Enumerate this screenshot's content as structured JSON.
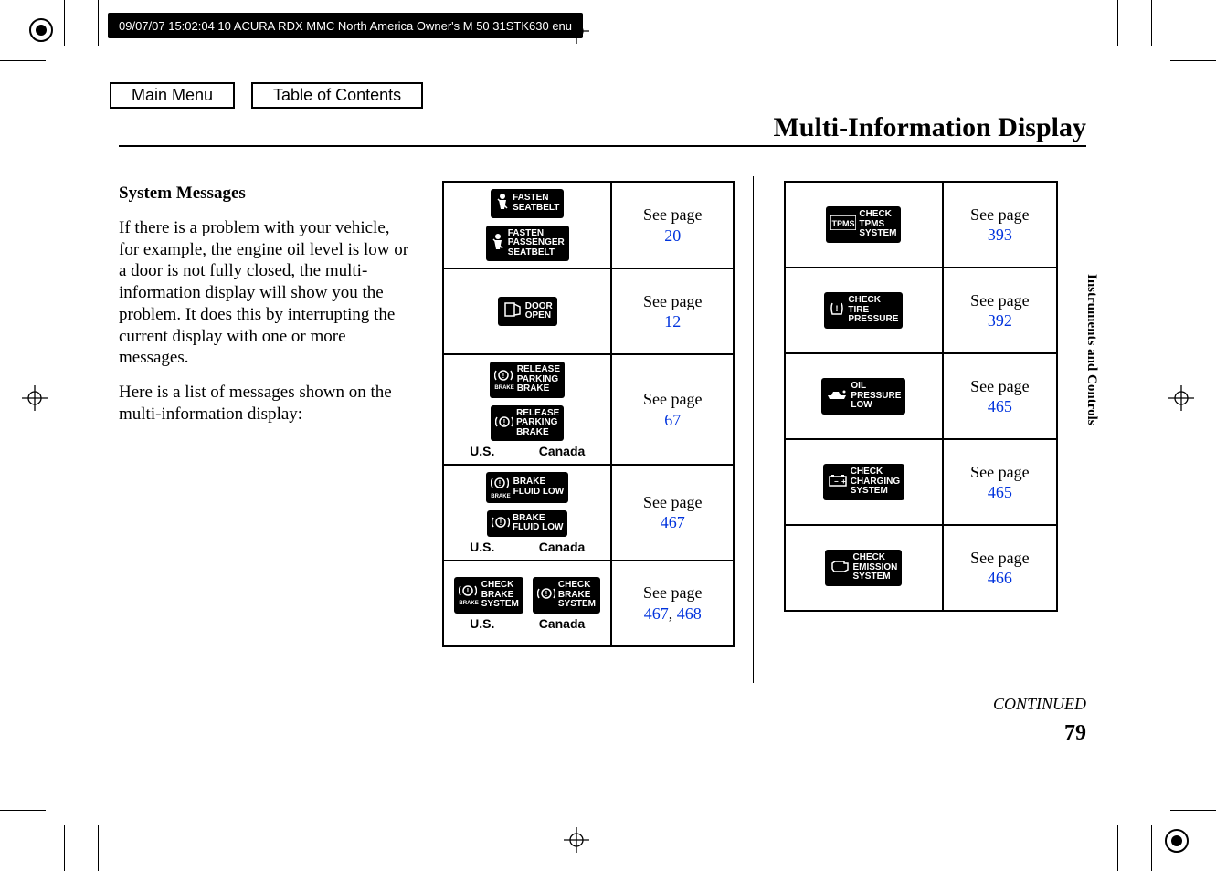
{
  "header_text": "09/07/07 15:02:04   10 ACURA RDX MMC North America Owner's M 50 31STK630 enu",
  "nav": {
    "main_menu": "Main Menu",
    "toc": "Table of Contents"
  },
  "page_title": "Multi-Information Display",
  "section": {
    "heading": "System Messages",
    "para1": "If there is a problem with your vehicle, for example, the engine oil level is low or a door is not fully closed, the multi-information display will show you the problem. It does this by interrupting the current display with one or more messages.",
    "para2": "Here is a list of messages shown on the multi-information display:"
  },
  "see_page_label": "See page",
  "variant_us": "U.S.",
  "variant_canada": "Canada",
  "left_table": [
    {
      "variant_row": false,
      "indicators": [
        {
          "name": "fasten-seatbelt-indicator",
          "text": "FASTEN\nSEATBELT"
        },
        {
          "name": "fasten-passenger-seatbelt-indicator",
          "text": "FASTEN\nPASSENGER\nSEATBELT"
        }
      ],
      "pages": [
        "20"
      ]
    },
    {
      "variant_row": false,
      "indicators": [
        {
          "name": "door-open-indicator",
          "text": "DOOR\nOPEN"
        }
      ],
      "pages": [
        "12"
      ]
    },
    {
      "variant_row": true,
      "indicators": [
        {
          "name": "release-parking-brake-us-indicator",
          "text": "RELEASE\nPARKING\nBRAKE",
          "prefix": "BRAKE"
        },
        {
          "name": "release-parking-brake-canada-indicator",
          "text": "RELEASE\nPARKING\nBRAKE"
        }
      ],
      "pages": [
        "67"
      ]
    },
    {
      "variant_row": true,
      "indicators": [
        {
          "name": "brake-fluid-low-us-indicator",
          "text": "BRAKE\nFLUID LOW",
          "prefix": "BRAKE"
        },
        {
          "name": "brake-fluid-low-canada-indicator",
          "text": "BRAKE\nFLUID LOW"
        }
      ],
      "pages": [
        "467"
      ]
    },
    {
      "variant_row": true,
      "indicators": [
        {
          "name": "check-brake-system-us-indicator",
          "text": "CHECK\nBRAKE\nSYSTEM",
          "prefix": "BRAKE"
        },
        {
          "name": "check-brake-system-canada-indicator",
          "text": "CHECK\nBRAKE\nSYSTEM"
        }
      ],
      "pages": [
        "467",
        "468"
      ]
    }
  ],
  "right_table": [
    {
      "indicators": [
        {
          "name": "check-tpms-system-indicator",
          "text": "CHECK\nTPMS\nSYSTEM",
          "prefix_box": "TPMS"
        }
      ],
      "pages": [
        "393"
      ]
    },
    {
      "indicators": [
        {
          "name": "check-tire-pressure-indicator",
          "text": "CHECK\nTIRE\nPRESSURE"
        }
      ],
      "pages": [
        "392"
      ]
    },
    {
      "indicators": [
        {
          "name": "oil-pressure-low-indicator",
          "text": "OIL\nPRESSURE\nLOW"
        }
      ],
      "pages": [
        "465"
      ]
    },
    {
      "indicators": [
        {
          "name": "check-charging-system-indicator",
          "text": "CHECK\nCHARGING\nSYSTEM"
        }
      ],
      "pages": [
        "465"
      ]
    },
    {
      "indicators": [
        {
          "name": "check-emission-system-indicator",
          "text": "CHECK\nEMISSION\nSYSTEM"
        }
      ],
      "pages": [
        "466"
      ]
    }
  ],
  "side_tab": "Instruments and Controls",
  "continued": "CONTINUED",
  "page_number": "79"
}
